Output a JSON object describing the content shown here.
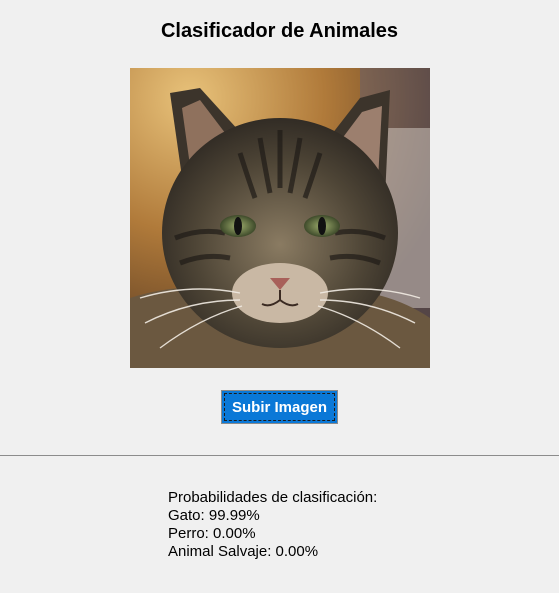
{
  "app": {
    "title": "Clasificador de Animales"
  },
  "image": {
    "subject": "cat-photo"
  },
  "upload_button": {
    "label": "Subir Imagen"
  },
  "results": {
    "heading": "Probabilidades de clasificación:",
    "items": [
      {
        "text": "Gato: 99.99%"
      },
      {
        "text": "Perro: 0.00%"
      },
      {
        "text": "Animal Salvaje: 0.00%"
      }
    ]
  },
  "colors": {
    "background": "#f0f0f0",
    "button_bg": "#0a78d7",
    "button_text": "#ffffff"
  }
}
